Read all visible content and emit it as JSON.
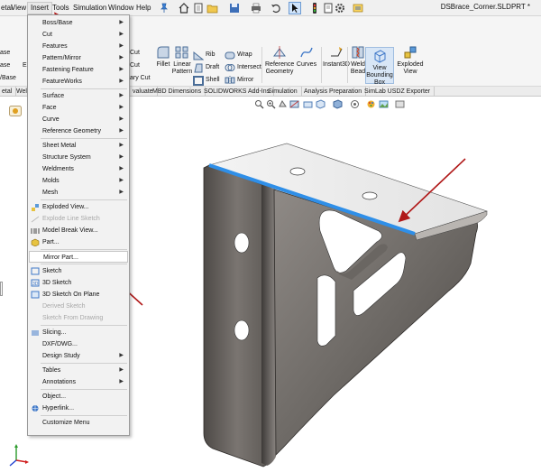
{
  "menubar": {
    "items": [
      "etal",
      "View",
      "Insert",
      "Tools",
      "Simulation",
      "Window",
      "Help"
    ],
    "active": "Insert"
  },
  "document": {
    "title": "DSBrace_Corner.SLDPRT *"
  },
  "ribbon": {
    "left_cut": [
      "ase",
      "ase",
      "/Base"
    ],
    "right_cut_labels": [
      "Cut",
      "Cut",
      "ary Cut"
    ],
    "fillet": "Fillet",
    "linear_pattern": "Linear Pattern",
    "rib": "Rib",
    "draft": "Draft",
    "shell": "Shell",
    "wrap": "Wrap",
    "intersect": "Intersect",
    "mirror": "Mirror",
    "reference_geometry": "Reference Geometry",
    "curves": "Curves",
    "instant3d": "Instant3D",
    "weld_bead": "Weld Bead",
    "view_bounding_box": "View Bounding Box",
    "exploded_view": "Exploded View"
  },
  "tabs": [
    "etal",
    "Wel",
    "valuate",
    "MBD Dimensions",
    "SOLIDWORKS Add-Ins",
    "Simulation",
    "Analysis Preparation",
    "SimLab USDZ Exporter"
  ],
  "insert_menu": {
    "items": [
      {
        "label": "Boss/Base",
        "submenu": true
      },
      {
        "label": "Cut",
        "submenu": true
      },
      {
        "label": "Features",
        "submenu": true
      },
      {
        "label": "Pattern/Mirror",
        "submenu": true
      },
      {
        "label": "Fastening Feature",
        "submenu": true
      },
      {
        "label": "FeatureWorks",
        "submenu": true
      },
      {
        "label": "Surface",
        "submenu": true
      },
      {
        "label": "Face",
        "submenu": true
      },
      {
        "label": "Curve",
        "submenu": true
      },
      {
        "label": "Reference Geometry",
        "submenu": true
      },
      {
        "label": "Sheet Metal",
        "submenu": true
      },
      {
        "label": "Structure System",
        "submenu": true
      },
      {
        "label": "Weldments",
        "submenu": true
      },
      {
        "label": "Molds",
        "submenu": true
      },
      {
        "label": "Mesh",
        "submenu": true
      },
      {
        "label": "Exploded View...",
        "submenu": false
      },
      {
        "label": "Explode Line Sketch",
        "submenu": false,
        "disabled": true
      },
      {
        "label": "Model Break View...",
        "submenu": false
      },
      {
        "label": "Part...",
        "submenu": false
      },
      {
        "label": "Mirror Part...",
        "submenu": false,
        "highlight": true
      },
      {
        "label": "Sketch",
        "submenu": false
      },
      {
        "label": "3D Sketch",
        "submenu": false
      },
      {
        "label": "3D Sketch On Plane",
        "submenu": false
      },
      {
        "label": "Derived Sketch",
        "submenu": false,
        "disabled": true
      },
      {
        "label": "Sketch From Drawing",
        "submenu": false,
        "disabled": true
      },
      {
        "label": "Slicing...",
        "submenu": false
      },
      {
        "label": "DXF/DWG...",
        "submenu": false
      },
      {
        "label": "Design Study",
        "submenu": true
      },
      {
        "label": "Tables",
        "submenu": true
      },
      {
        "label": "Annotations",
        "submenu": true
      },
      {
        "label": "Object...",
        "submenu": false
      },
      {
        "label": "Hyperlink...",
        "submenu": false
      },
      {
        "label": "Customize Menu",
        "submenu": false
      }
    ]
  },
  "colors": {
    "accent_blue": "#2f8fe8",
    "annotation_arrow": "#b01818",
    "part_metal": "#6e6a66"
  },
  "icons": {
    "home": "home-icon",
    "open": "open-icon",
    "save": "save-icon",
    "print": "print-icon",
    "undo": "undo-icon",
    "select": "select-cursor-icon",
    "rebuild": "traffic-light-icon",
    "options": "gear-icon"
  }
}
